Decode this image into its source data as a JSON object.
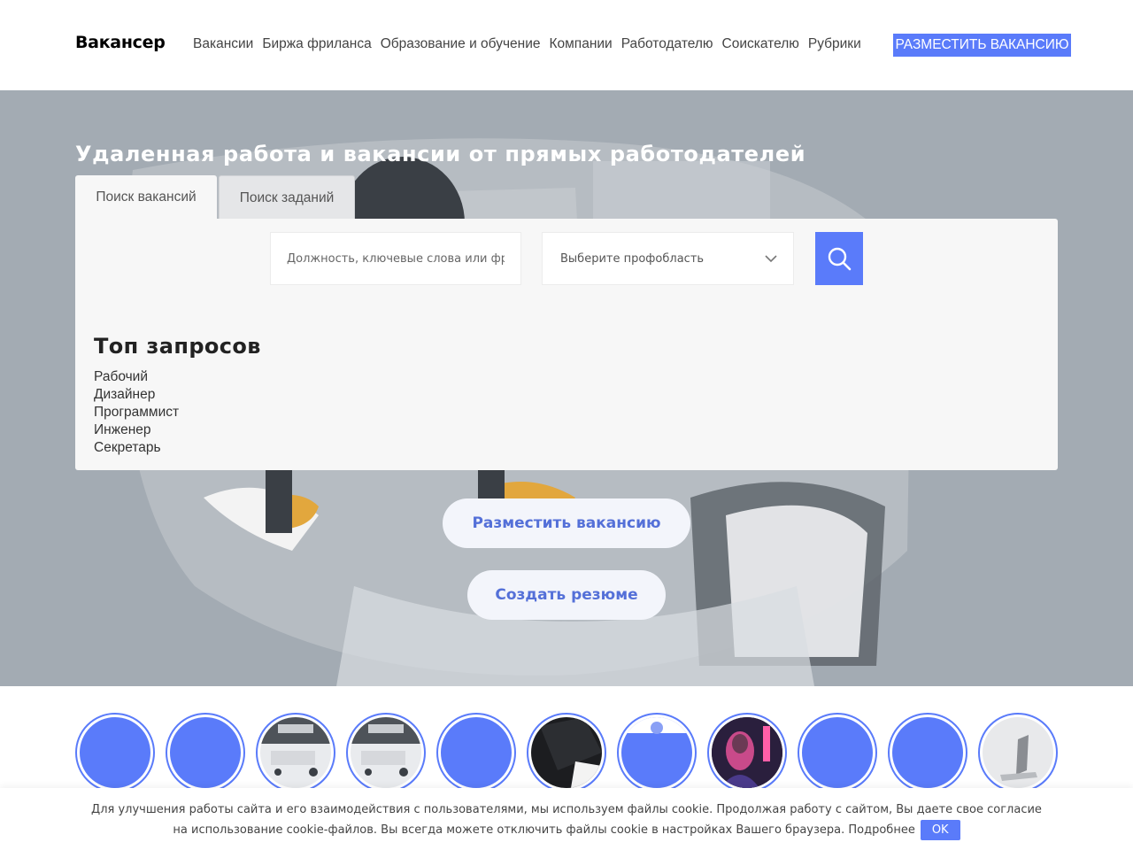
{
  "header": {
    "logo": "Вакансер",
    "nav": [
      "Вакансии",
      "Биржа фриланса",
      "Образование и обучение",
      "Компании",
      "Работодателю",
      "Соискателю",
      "Рубрики"
    ],
    "post_vacancy": "РАЗМЕСТИТЬ ВАКАНСИЮ"
  },
  "hero": {
    "title": "Удаленная работа и вакансии от прямых работодателей",
    "tabs": [
      "Поиск вакансий",
      "Поиск заданий"
    ],
    "search": {
      "placeholder": "Должность, ключевые слова или фр",
      "select_value": "Выберите профобласть"
    },
    "top_title": "Топ запросов",
    "top_queries": [
      "Рабочий",
      "Дизайнер",
      "Программист",
      "Инженер",
      "Секретарь"
    ],
    "cta_vacancy": "Разместить вакансию",
    "cta_resume": "Создать резюме"
  },
  "categories": [
    {
      "icon": "blue-circle"
    },
    {
      "icon": "blue-circle"
    },
    {
      "icon": "desk-photo"
    },
    {
      "icon": "desk-photo"
    },
    {
      "icon": "blue-circle"
    },
    {
      "icon": "dark-photo"
    },
    {
      "icon": "blue-circle"
    },
    {
      "icon": "neon-photo"
    },
    {
      "icon": "blue-circle"
    },
    {
      "icon": "blue-circle"
    },
    {
      "icon": "laptop-photo"
    }
  ],
  "cookie": {
    "text": "Для улучшения работы сайта и его взаимодействия с пользователями, мы используем файлы cookie. Продолжая работу с сайтом, Вы даете свое согласие на использование cookie-файлов. Вы всегда можете отключить файлы cookie в настройках Вашего браузера. Подробнее",
    "ok": "OK"
  },
  "colors": {
    "accent": "#5a7bfa",
    "hero_bg": "#a3abb3",
    "panel_bg": "#f7f7f7"
  }
}
